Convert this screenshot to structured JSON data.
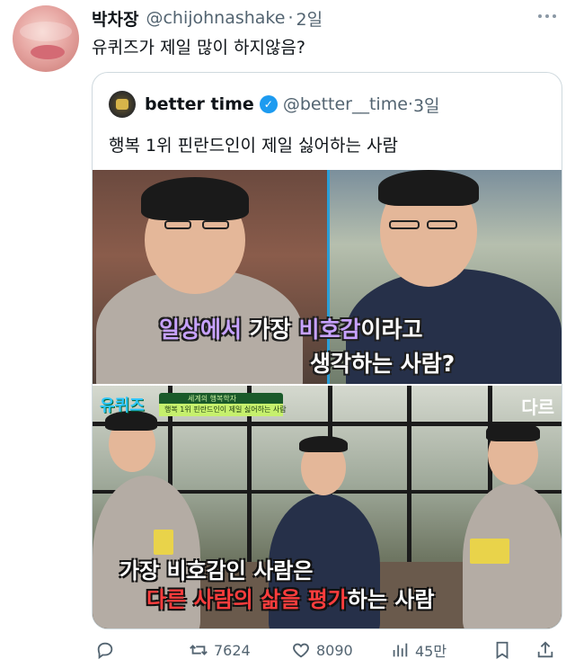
{
  "tweet": {
    "author_name": "박차장",
    "author_handle": "@chijohnashake",
    "time": "2일",
    "text": "유퀴즈가 제일 많이 하지않음?"
  },
  "quote": {
    "author_name": "better time",
    "author_handle": "@better__time",
    "time": "3일",
    "text": "행복 1위 핀란드인이 제일 싫어하는 사람"
  },
  "image1": {
    "caption_line1_a": "일상에서",
    "caption_line1_b": "가장",
    "caption_line1_c": "비호감",
    "caption_line1_d": "이라고",
    "caption_line2": "생각하는 사람?"
  },
  "image2": {
    "show_logo": "유퀴즈",
    "badge_top": "세계의 행복학자",
    "badge_bottom": "행복 1위 핀란드인이 제일 싫어하는 사람",
    "corner_text": "다르",
    "caption_line1": "가장 비호감인 사람은",
    "caption_line2_a": "다른 사람의 삶을 평가",
    "caption_line2_b": "하는 사람"
  },
  "actions": {
    "retweets": "7624",
    "likes": "8090",
    "views": "45만"
  },
  "colors": {
    "verified": "#1d9bf0",
    "muted": "#536471",
    "caption_accent_purple": "#c7a2ff",
    "caption_accent_red": "#ff3d3d"
  }
}
